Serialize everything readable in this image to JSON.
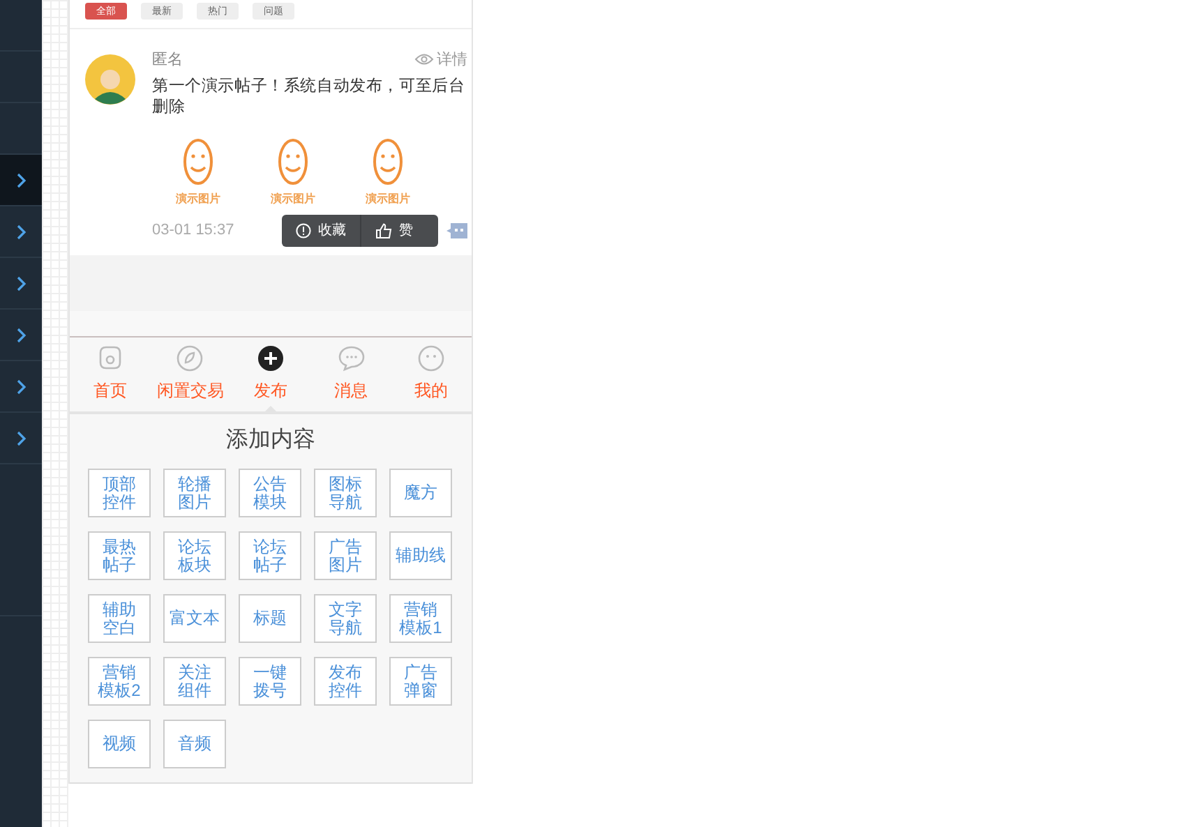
{
  "sidebar": {
    "items": [
      {
        "kind": "blank",
        "selected": false
      },
      {
        "kind": "blank",
        "selected": false
      },
      {
        "kind": "blank",
        "selected": false
      },
      {
        "kind": "expand",
        "selected": true
      },
      {
        "kind": "expand",
        "selected": false
      },
      {
        "kind": "expand",
        "selected": false
      },
      {
        "kind": "expand",
        "selected": false
      },
      {
        "kind": "expand",
        "selected": false
      },
      {
        "kind": "expand",
        "selected": false
      }
    ]
  },
  "filter_tabs": [
    {
      "label": "全部",
      "selected": true
    },
    {
      "label": "最新",
      "selected": false
    },
    {
      "label": "热门",
      "selected": false
    },
    {
      "label": "问题",
      "selected": false
    }
  ],
  "post": {
    "author": "匿名",
    "details_link": "详情",
    "text": "第一个演示帖子！系统自动发布，可至后台删除",
    "images": [
      {
        "caption": "演示图片"
      },
      {
        "caption": "演示图片"
      },
      {
        "caption": "演示图片"
      }
    ],
    "time": "03-01 15:37",
    "actions": [
      "收藏",
      "赞"
    ]
  },
  "tab_bar": [
    {
      "label": "首页",
      "kind": "home",
      "selected": false
    },
    {
      "label": "闲置交易",
      "kind": "leaf",
      "selected": false
    },
    {
      "label": "发布",
      "kind": "plus",
      "selected": true
    },
    {
      "label": "消息",
      "kind": "chat",
      "selected": false
    },
    {
      "label": "我的",
      "kind": "face",
      "selected": false
    }
  ],
  "add_panel": {
    "title": "添加内容",
    "items": [
      "顶部控件",
      "轮播图片",
      "公告模块",
      "图标导航",
      "魔方",
      "最热帖子",
      "论坛板块",
      "论坛帖子",
      "广告图片",
      "辅助线",
      "辅助空白",
      "富文本",
      "标题",
      "文字导航",
      "营销模板1",
      "营销模板2",
      "关注组件",
      "一键拨号",
      "发布控件",
      "广告弹窗",
      "视频",
      "音频"
    ]
  }
}
